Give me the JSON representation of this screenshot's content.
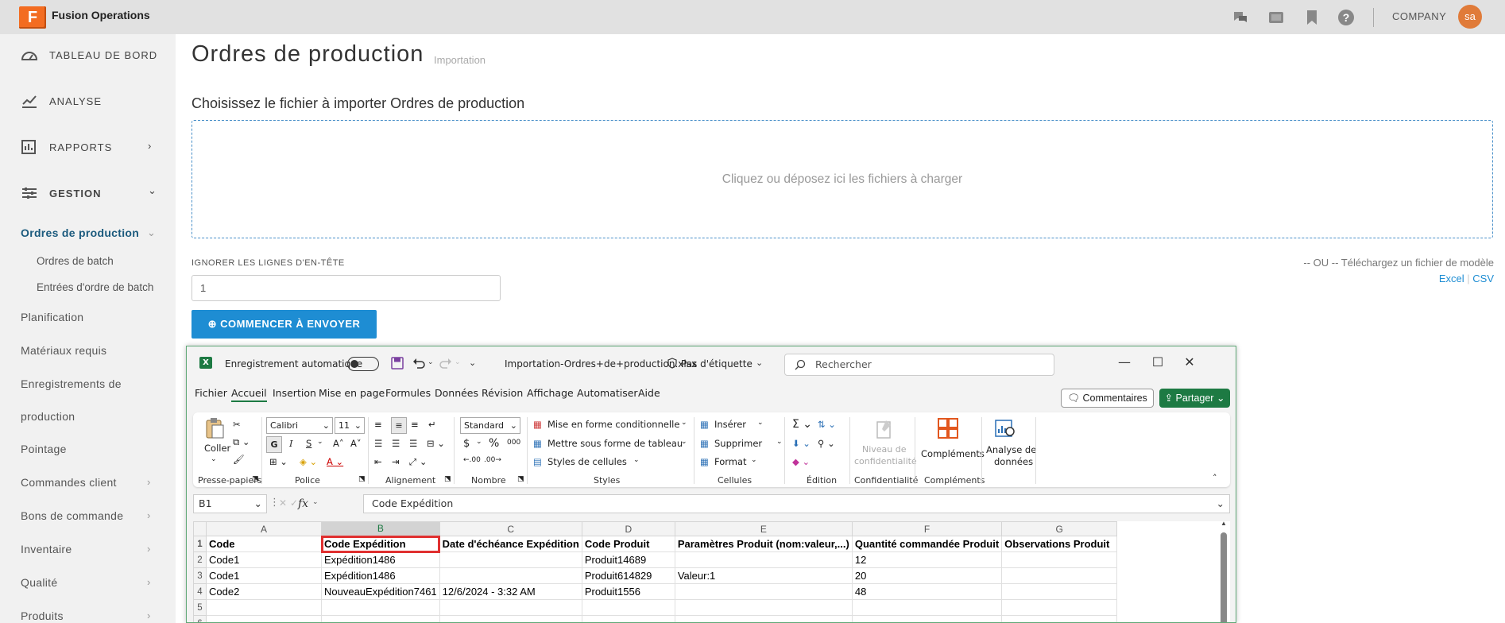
{
  "app": {
    "logo_letter": "F",
    "title": "Fusion Operations",
    "company": "COMPANY",
    "avatar_initials": "sa",
    "accent_color": "#f36c21",
    "primary_color": "#1e8dd3"
  },
  "topbar_icons": [
    "chat-icon",
    "display-icon",
    "bookmark-icon",
    "help-icon"
  ],
  "sidebar": {
    "main_items": [
      {
        "label": "TABLEAU DE BORD",
        "icon": "dashboard-icon"
      },
      {
        "label": "ANALYSE",
        "icon": "analytics-icon"
      },
      {
        "label": "RAPPORTS",
        "icon": "reports-icon",
        "chevron": "›"
      },
      {
        "label": "GESTION",
        "icon": "management-icon",
        "chevron": "⌄"
      }
    ],
    "active_item": "Ordres de production",
    "sub_items": [
      "Ordres de batch",
      "Entrées d'ordre de batch"
    ],
    "items": [
      "Planification",
      "Matériaux requis",
      "Enregistrements de",
      "production",
      "Pointage"
    ],
    "expandable_items": [
      "Commandes client",
      "Bons de commande",
      "Inventaire",
      "Qualité",
      "Produits"
    ]
  },
  "main": {
    "title": "Ordres de production",
    "subtitle": "Importation",
    "section_title": "Choisissez le fichier à importer Ordres de production",
    "dropzone_text": "Cliquez ou déposez ici les fichiers à charger",
    "ignore_label": "IGNORER LES LIGNES D'EN-TÊTE",
    "ignore_value": "1",
    "start_button": "⊕ COMMENCER À ENVOYER",
    "model_text": "-- OU -- Téléchargez un fichier de modèle",
    "model_excel": "Excel",
    "model_sep": "|",
    "model_csv": "CSV"
  },
  "excel": {
    "autosave_label": "Enregistrement automatique",
    "filename": "Importation-Ordres+de+production.xlsx",
    "label_text": "Pas d'étiquette",
    "search_placeholder": "Rechercher",
    "menu": [
      "Fichier",
      "Accueil",
      "Insertion",
      "Mise en page",
      "Formules",
      "Données",
      "Révision",
      "Affichage",
      "Automatiser",
      "Aide"
    ],
    "active_menu": "Accueil",
    "comments_button": "Commentaires",
    "share_button": "Partager",
    "ribbon": {
      "paste": "Coller",
      "font_name": "Calibri",
      "font_size": "11",
      "number_format": "Standard",
      "conditional_format": "Mise en forme conditionnelle",
      "format_table": "Mettre sous forme de tableau",
      "cell_styles": "Styles de cellules",
      "insert": "Insérer",
      "delete": "Supprimer",
      "format": "Format",
      "sensitivity_1": "Niveau de",
      "sensitivity_2": "confidentialité",
      "addins": "Compléments",
      "analyze_1": "Analyse de",
      "analyze_2": "données",
      "groups": [
        "Presse-papiers",
        "Police",
        "Alignement",
        "Nombre",
        "Styles",
        "Cellules",
        "Édition",
        "Confidentialité",
        "Compléments"
      ],
      "bold": "G",
      "italic": "I",
      "underline": "S",
      "currency": "$",
      "percent": "%",
      "thousands": "000"
    },
    "name_box": "B1",
    "fx": "fx",
    "formula": "Code Expédition",
    "columns": [
      "A",
      "B",
      "C",
      "D",
      "E",
      "F",
      "G"
    ],
    "rows": [
      [
        "1",
        "Code",
        "Code Expédition",
        "Date d'échéance Expédition",
        "Code Produit",
        "Paramètres Produit (nom:valeur,...)",
        "Quantité commandée Produit",
        "Observations Produit"
      ],
      [
        "2",
        "Code1",
        "Expédition1486",
        "",
        "Produit14689",
        "",
        "12",
        ""
      ],
      [
        "3",
        "Code1",
        "Expédition1486",
        "",
        "Produit614829",
        "Valeur:1",
        "20",
        ""
      ],
      [
        "4",
        "Code2",
        "NouveauExpédition7461",
        "12/6/2024 - 3:32 AM",
        "Produit1556",
        "",
        "48",
        ""
      ],
      [
        "5",
        "",
        "",
        "",
        "",
        "",
        "",
        ""
      ],
      [
        "6",
        "",
        "",
        "",
        "",
        "",
        "",
        ""
      ]
    ]
  }
}
